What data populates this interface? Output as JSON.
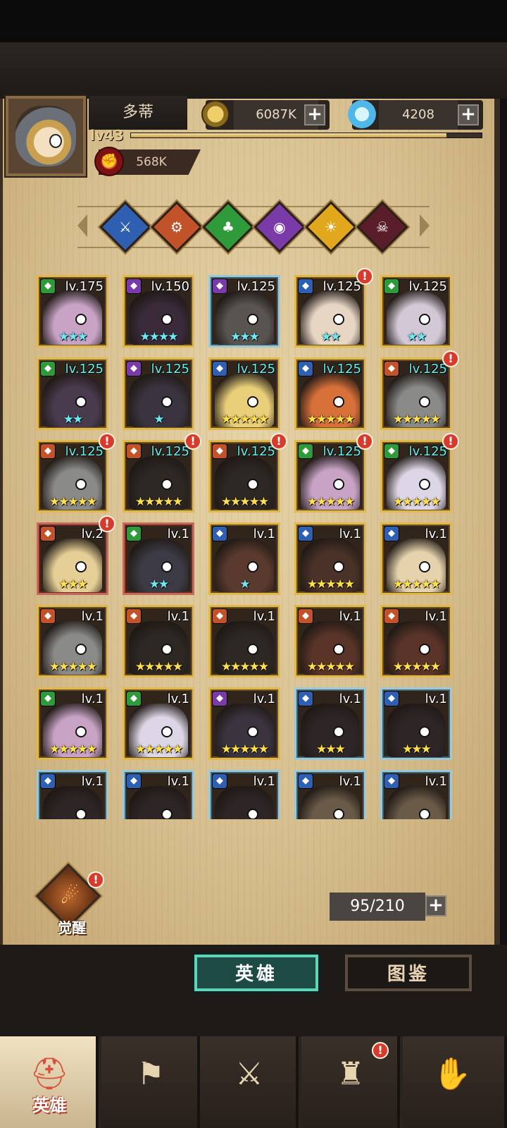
{
  "player": {
    "name": "多蒂",
    "level": "lv43",
    "xp_progress": 0.9,
    "power": "568K"
  },
  "resources": {
    "gold": "6087K",
    "gems": "4208",
    "plus": "+"
  },
  "factions": [
    {
      "name": "sword-faction-icon",
      "color": "#2f5fb0",
      "glyph": "⚔"
    },
    {
      "name": "gear-faction-icon",
      "color": "#c2522a",
      "glyph": "⚙"
    },
    {
      "name": "clover-faction-icon",
      "color": "#2f9a3a",
      "glyph": "♣"
    },
    {
      "name": "eye-faction-icon",
      "color": "#7a3aa8",
      "glyph": "◉"
    },
    {
      "name": "sun-faction-icon",
      "color": "#e1a81d",
      "glyph": "☀"
    },
    {
      "name": "skull-faction-icon",
      "color": "#5a1e2a",
      "glyph": "☠"
    }
  ],
  "heroes": [
    {
      "level": "lv.175",
      "stars": 3,
      "star_color": "cyan",
      "frame": "gold",
      "cls": "#2f9a3a",
      "skin": "#c8a3c6",
      "alert": false
    },
    {
      "level": "lv.150",
      "stars": 4,
      "star_color": "cyan",
      "frame": "gold",
      "cls": "#7a3aa8",
      "skin": "#3a2a3a",
      "alert": false
    },
    {
      "level": "lv.125",
      "stars": 3,
      "star_color": "cyan",
      "frame": "blue",
      "cls": "#7a3aa8",
      "skin": "#5a5450",
      "alert": false
    },
    {
      "level": "lv.125",
      "stars": 2,
      "star_color": "cyan",
      "frame": "gold",
      "cls": "#2f5fb0",
      "skin": "#e8d6c4",
      "alert": true
    },
    {
      "level": "lv.125",
      "stars": 2,
      "star_color": "cyan",
      "frame": "gold",
      "cls": "#2f9a3a",
      "skin": "#d3c9d6",
      "alert": false
    },
    {
      "level": "lv.125",
      "stars": 2,
      "star_color": "cyan",
      "frame": "gold",
      "cls": "#2f9a3a",
      "skin": "#4a3a4e",
      "alert": false
    },
    {
      "level": "lv.125",
      "stars": 1,
      "star_color": "cyan",
      "frame": "gold",
      "cls": "#7a3aa8",
      "skin": "#3a3440",
      "alert": false
    },
    {
      "level": "lv.125",
      "stars": 5,
      "star_color": "yellow",
      "frame": "gold",
      "cls": "#2f5fb0",
      "skin": "#e9cf7a",
      "alert": false
    },
    {
      "level": "lv.125",
      "stars": 5,
      "star_color": "yellow",
      "frame": "gold",
      "cls": "#2f5fb0",
      "skin": "#d8703a",
      "alert": false
    },
    {
      "level": "lv.125",
      "stars": 5,
      "star_color": "yellow",
      "frame": "gold",
      "cls": "#c2522a",
      "skin": "#8a8a88",
      "alert": true
    },
    {
      "level": "lv.125",
      "stars": 5,
      "star_color": "yellow",
      "frame": "gold",
      "cls": "#c2522a",
      "skin": "#8a8a88",
      "alert": true
    },
    {
      "level": "lv.125",
      "stars": 5,
      "star_color": "yellow",
      "frame": "gold",
      "cls": "#c2522a",
      "skin": "#2e2824",
      "alert": true
    },
    {
      "level": "lv.125",
      "stars": 5,
      "star_color": "yellow",
      "frame": "gold",
      "cls": "#c2522a",
      "skin": "#2e2824",
      "alert": true
    },
    {
      "level": "lv.125",
      "stars": 5,
      "star_color": "yellow",
      "frame": "gold",
      "cls": "#2f9a3a",
      "skin": "#c8a3c6",
      "alert": true
    },
    {
      "level": "lv.125",
      "stars": 5,
      "star_color": "yellow",
      "frame": "gold",
      "cls": "#2f9a3a",
      "skin": "#dcd6e6",
      "alert": true
    },
    {
      "level": "lv.2",
      "stars": 3,
      "star_color": "yellow",
      "frame": "red",
      "cls": "#c2522a",
      "skin": "#e6cf96",
      "alert": true
    },
    {
      "level": "lv.1",
      "stars": 2,
      "star_color": "cyan",
      "frame": "red",
      "cls": "#2f9a3a",
      "skin": "#3c3a44",
      "alert": false
    },
    {
      "level": "lv.1",
      "stars": 1,
      "star_color": "cyan",
      "frame": "gold",
      "cls": "#2f5fb0",
      "skin": "#5a3a2e",
      "alert": false
    },
    {
      "level": "lv.1",
      "stars": 5,
      "star_color": "yellow",
      "frame": "gold",
      "cls": "#2f5fb0",
      "skin": "#4a3228",
      "alert": false
    },
    {
      "level": "lv.1",
      "stars": 5,
      "star_color": "yellow",
      "frame": "gold",
      "cls": "#2f5fb0",
      "skin": "#e6d3ae",
      "alert": false
    },
    {
      "level": "lv.1",
      "stars": 5,
      "star_color": "yellow",
      "frame": "gold",
      "cls": "#c2522a",
      "skin": "#8a8a88",
      "alert": false
    },
    {
      "level": "lv.1",
      "stars": 5,
      "star_color": "yellow",
      "frame": "gold",
      "cls": "#c2522a",
      "skin": "#2e2824",
      "alert": false
    },
    {
      "level": "lv.1",
      "stars": 5,
      "star_color": "yellow",
      "frame": "gold",
      "cls": "#c2522a",
      "skin": "#2e2824",
      "alert": false
    },
    {
      "level": "lv.1",
      "stars": 5,
      "star_color": "yellow",
      "frame": "gold",
      "cls": "#c2522a",
      "skin": "#5a3428",
      "alert": false
    },
    {
      "level": "lv.1",
      "stars": 5,
      "star_color": "yellow",
      "frame": "gold",
      "cls": "#c2522a",
      "skin": "#5a3428",
      "alert": false
    },
    {
      "level": "lv.1",
      "stars": 5,
      "star_color": "yellow",
      "frame": "gold",
      "cls": "#2f9a3a",
      "skin": "#c8a3c6",
      "alert": false
    },
    {
      "level": "lv.1",
      "stars": 5,
      "star_color": "yellow",
      "frame": "gold",
      "cls": "#2f9a3a",
      "skin": "#dcd6e6",
      "alert": false
    },
    {
      "level": "lv.1",
      "stars": 5,
      "star_color": "yellow",
      "frame": "gold",
      "cls": "#7a3aa8",
      "skin": "#3a3440",
      "alert": false
    },
    {
      "level": "lv.1",
      "stars": 3,
      "star_color": "yellow",
      "frame": "blue",
      "cls": "#2f5fb0",
      "skin": "#2e2626",
      "alert": false
    },
    {
      "level": "lv.1",
      "stars": 3,
      "star_color": "yellow",
      "frame": "blue",
      "cls": "#2f5fb0",
      "skin": "#2e2626",
      "alert": false
    },
    {
      "level": "lv.1",
      "stars": 0,
      "star_color": "yellow",
      "frame": "blue",
      "cls": "#2f5fb0",
      "skin": "#2e2626",
      "alert": false
    },
    {
      "level": "lv.1",
      "stars": 0,
      "star_color": "yellow",
      "frame": "blue",
      "cls": "#2f5fb0",
      "skin": "#2e2626",
      "alert": false
    },
    {
      "level": "lv.1",
      "stars": 0,
      "star_color": "yellow",
      "frame": "blue",
      "cls": "#2f5fb0",
      "skin": "#2e2626",
      "alert": false
    },
    {
      "level": "lv.1",
      "stars": 0,
      "star_color": "yellow",
      "frame": "blue",
      "cls": "#2f5fb0",
      "skin": "#6a5a48",
      "alert": false
    },
    {
      "level": "lv.1",
      "stars": 0,
      "star_color": "yellow",
      "frame": "blue",
      "cls": "#2f5fb0",
      "skin": "#6a5a48",
      "alert": false
    }
  ],
  "awaken": {
    "label": "觉醒",
    "alert": "!"
  },
  "hero_count": "95/210",
  "tabs": {
    "heroes": "英雄",
    "codex": "图鉴"
  },
  "nav": [
    {
      "icon": "helmet-icon",
      "glyph": "⛑",
      "label": "英雄",
      "active": true
    },
    {
      "icon": "flag-icon",
      "glyph": "⚑",
      "active": false
    },
    {
      "icon": "crossed-swords-icon",
      "glyph": "⚔",
      "active": false
    },
    {
      "icon": "tower-icon",
      "glyph": "♜",
      "active": false,
      "alert": true
    },
    {
      "icon": "handshake-icon",
      "glyph": "✋",
      "active": false
    }
  ]
}
